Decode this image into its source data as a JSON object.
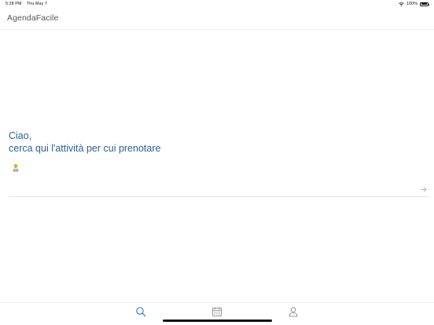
{
  "status_bar": {
    "time": "5:28 PM",
    "date": "Thu May 7",
    "battery": "100%",
    "icons": [
      "wifi-icon",
      "battery-icon"
    ]
  },
  "header": {
    "title": "AgendaFacile"
  },
  "main": {
    "greeting_line1": "Ciao,",
    "greeting_line2": "cerca qui l'attività per cui prenotare",
    "emoji": "person-emoji-icon",
    "search": {
      "value": "",
      "placeholder": ""
    },
    "submit_icon": "arrow-right-icon"
  },
  "tab_bar": {
    "items": [
      {
        "name": "search",
        "icon": "search-icon",
        "active": true
      },
      {
        "name": "calendar",
        "icon": "calendar-icon",
        "active": false
      },
      {
        "name": "profile",
        "icon": "person-icon",
        "active": false
      }
    ]
  },
  "colors": {
    "accent": "#2f5f8f",
    "tab_active": "#3478c8",
    "tab_inactive": "#8a8a8a"
  }
}
